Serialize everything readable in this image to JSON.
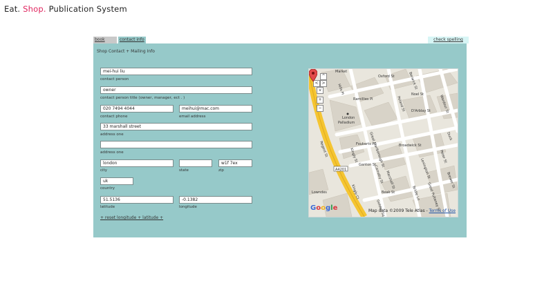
{
  "brand": {
    "part1": "Eat.",
    "part2": "Shop.",
    "part3": "Publication System"
  },
  "tabs": {
    "book_copy": "book copy",
    "contact_info": "contact info",
    "check_spelling": "check spelling"
  },
  "section_title": "Shop Contact + Mailing Info",
  "fields": {
    "contact_person": {
      "value": "mei-hui liu",
      "label": "contact person"
    },
    "contact_title": {
      "value": "owner",
      "label": "contact person title (owner, manager, ect . )"
    },
    "contact_phone": {
      "value": "020 7494 4044",
      "label": "contact phone"
    },
    "email": {
      "value": "meihui@mac.com",
      "label": "email address"
    },
    "address_one": {
      "value": "33 marshall street",
      "label": "address one"
    },
    "address_two": {
      "value": "",
      "label": "address one"
    },
    "city": {
      "value": "london",
      "label": "city"
    },
    "state": {
      "value": "",
      "label": "state"
    },
    "zip": {
      "value": "w1f 7ex",
      "label": "zip"
    },
    "country": {
      "value": "uk",
      "label": "country"
    },
    "latitude": {
      "value": "51.5136",
      "label": "latitude"
    },
    "longitude": {
      "value": "-0.1382",
      "label": "longitude"
    }
  },
  "reset_link": "+ reset longitude + latitude +",
  "map": {
    "controls": {
      "pan_up": "^",
      "pan_left": "<",
      "pan_right": ">",
      "pan_down": "v",
      "zoom_in": "+",
      "zoom_out": "−"
    },
    "streets": [
      "Market",
      "Oxford St",
      "Berwick St",
      "Hills Pl",
      "Ramillies Pl",
      "Noel St",
      "Wardour St",
      "Poland St",
      "D'Arblay St",
      "Duck",
      "Great Marlborough St",
      "London Palladium",
      "Kingly St",
      "Broadwick St",
      "Regent St",
      "Carnaby St",
      "Fouberts Pl",
      "Ganton St",
      "Marshall St",
      "Lexington St",
      "Peter St",
      "A4201",
      "Kingly Ct",
      "Beak St",
      "Bridle Ln",
      "Great Pulteney St",
      "Lowndes",
      "Brewer St",
      "Golden Sq"
    ],
    "copyright": "Map data ©2009 Tele Atlas -",
    "terms": "Terms of Use",
    "logo": "Google",
    "colors": {
      "major_road": "#f5c531",
      "minor_road": "#ffffff",
      "land": "#e9e6dd",
      "block": "#d8d3c8"
    }
  },
  "colors": {
    "panel": "#96c9c9",
    "accent": "#e0245e",
    "spell_tab": "#d7f5f5",
    "book_tab": "#c9c9c9"
  }
}
